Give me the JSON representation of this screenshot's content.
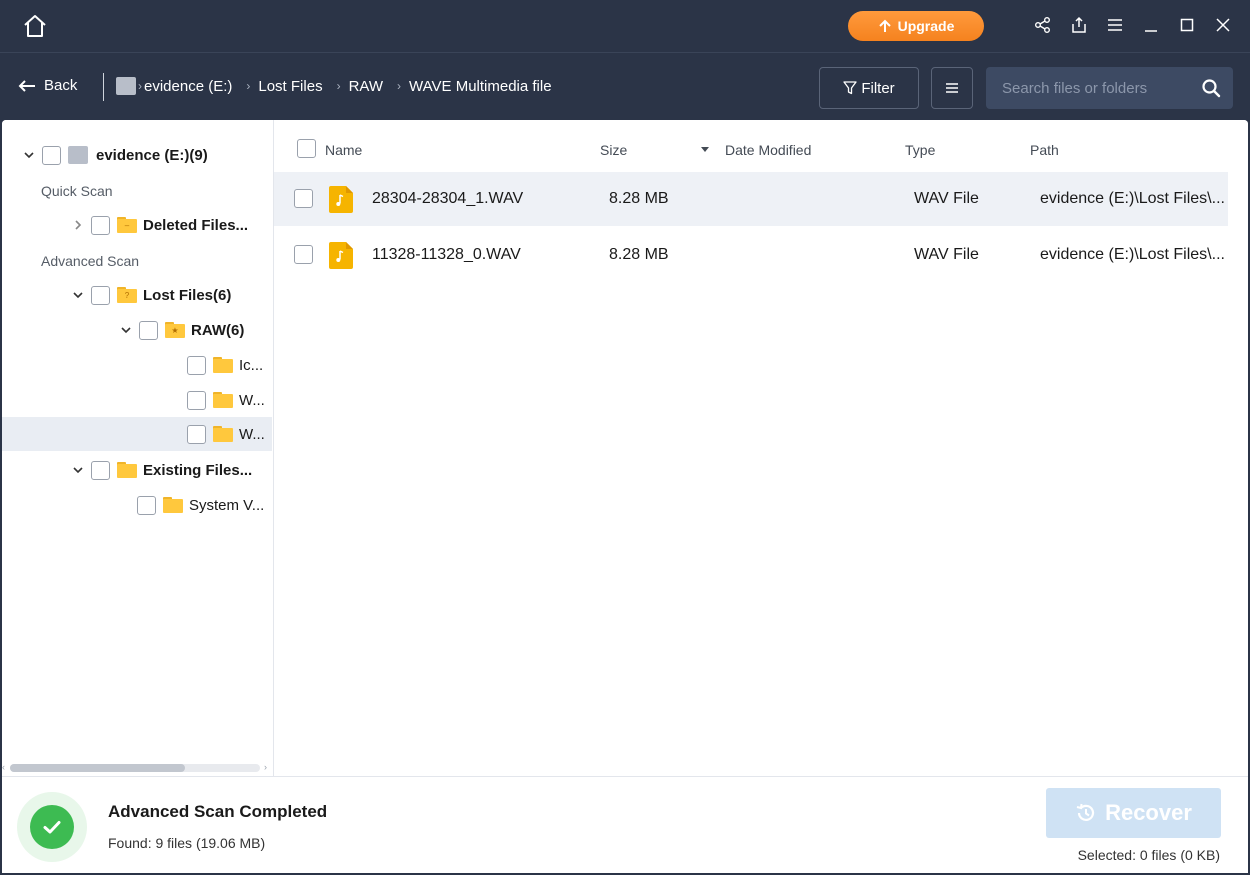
{
  "titlebar": {
    "upgrade_label": "Upgrade",
    "icons": [
      "home-icon",
      "share-icon",
      "export-icon",
      "menu-icon",
      "minimize-icon",
      "maximize-icon",
      "close-icon"
    ]
  },
  "nav": {
    "back_label": "Back",
    "breadcrumb": [
      "evidence (E:)",
      "Lost Files",
      "RAW",
      "WAVE Multimedia file"
    ],
    "filter_label": "Filter",
    "search_placeholder": "Search files or folders"
  },
  "sidebar": {
    "root": "evidence (E:)(9)",
    "quick_scan_label": "Quick Scan",
    "deleted_files": "Deleted Files...",
    "advanced_scan_label": "Advanced Scan",
    "lost_files": "Lost Files(6)",
    "raw": "RAW(6)",
    "raw_children": [
      "Ic...",
      "W...",
      "W..."
    ],
    "existing_files": "Existing Files...",
    "system_v": "System V..."
  },
  "list": {
    "headers": {
      "name": "Name",
      "size": "Size",
      "date": "Date Modified",
      "type": "Type",
      "path": "Path"
    },
    "rows": [
      {
        "name": "28304-28304_1.WAV",
        "size": "8.28 MB",
        "date": "",
        "type": "WAV File",
        "path": "evidence (E:)\\Lost Files\\..."
      },
      {
        "name": "11328-11328_0.WAV",
        "size": "8.28 MB",
        "date": "",
        "type": "WAV File",
        "path": "evidence (E:)\\Lost Files\\..."
      }
    ]
  },
  "status": {
    "title": "Advanced Scan Completed",
    "found": "Found: 9 files (19.06 MB)",
    "recover_label": "Recover",
    "selected": "Selected: 0 files (0 KB)"
  },
  "colors": {
    "chrome": "#2b3447",
    "accent_orange": "#f5821f",
    "folder": "#ffc83d",
    "success": "#3dbb52",
    "recover_disabled": "#cfe2f4"
  }
}
